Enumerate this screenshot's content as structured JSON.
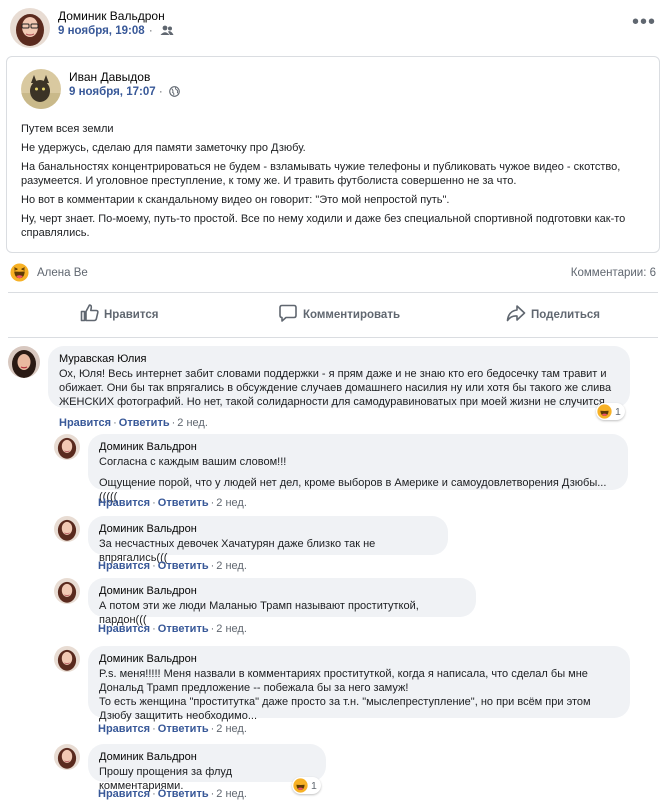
{
  "post": {
    "author": "Доминик Вальдрон",
    "date": "9 ноября, 19:08",
    "privacy_icon": "friends-icon",
    "more_icon": "•••"
  },
  "shared_post": {
    "author": "Иван Давыдов",
    "date": "9 ноября, 17:07",
    "privacy_icon": "globe-icon",
    "paragraphs": [
      "Путем всея земли",
      "Не удержусь, сделаю для памяти заметочку про Дзюбу.",
      "На банальностях концентрироваться не будем - взламывать чужие телефоны и публиковать чужое видео - скотство, разумеется. И уголовное преступление, к тому же. И травить футболиста совершенно не за что.",
      "Но вот в комментарии к скандальному видео он говорит: \"Это мой непростой путь\".",
      "Ну, черт знает. По-моему, путь-то простой. Все по нему ходили и даже без специальной спортивной подготовки как-то справлялись."
    ]
  },
  "reactions": {
    "emoji": "haha",
    "reactor": "Алена Ве",
    "comments_count": "Комментарии: 6"
  },
  "actions": {
    "like": "Нравится",
    "comment": "Комментировать",
    "share": "Поделиться"
  },
  "comment_actions": {
    "like": "Нравится",
    "reply": "Ответить",
    "sep": "·"
  },
  "comments": [
    {
      "author": "Муравская Юлия",
      "text": [
        "Ох, Юля! Весь интернет забит словами поддержки - я прям даже и не знаю кто его бедосечку там травит и обижает. Они бы так впрягались в обсуждение случаев домашнего насилия ну или хотя бы такого же слива ЖЕНСКИХ фотографий. Но нет, такой солидарности для самодуравиноватых при моей жизни не случится"
      ],
      "time": "2 нед.",
      "reaction": "1"
    },
    {
      "author": "Доминик Вальдрон",
      "text": [
        "Согласна с каждым вашим словом!!!",
        "Ощущение порой, что у людей нет дел, кроме выборов в Америке и самоудовлетворения Дзюбы...((((("
      ],
      "time": "2 нед."
    },
    {
      "author": "Доминик Вальдрон",
      "text": [
        "За несчастных девочек Хачатурян даже близко так не впрягались((("
      ],
      "time": "2 нед."
    },
    {
      "author": "Доминик Вальдрон",
      "text": [
        "А потом эти же люди Маланью Трамп называют проституткой, пардон((("
      ],
      "time": "2 нед."
    },
    {
      "author": "Доминик Вальдрон",
      "text": [
        "P.s. меня!!!!! Меня назвали в комментариях проституткой, когда я написала, что сделал бы мне Дональд Трамп предложение -- побежала бы за него замуж!<br>То есть женщина \"проститутка\" даже просто за т.н. \"мыслепреступление\", но при всём при этом Дзюбу защитить необходимо..."
      ],
      "time": "2 нед."
    },
    {
      "author": "Доминик Вальдрон",
      "text": [
        "Прошу прощения за флуд комментариями."
      ],
      "time": "2 нед.",
      "reaction": "1"
    }
  ],
  "colors": {
    "link": "#385898",
    "muted": "#606770",
    "bubble": "#f0f2f5",
    "border": "#dadde1"
  }
}
